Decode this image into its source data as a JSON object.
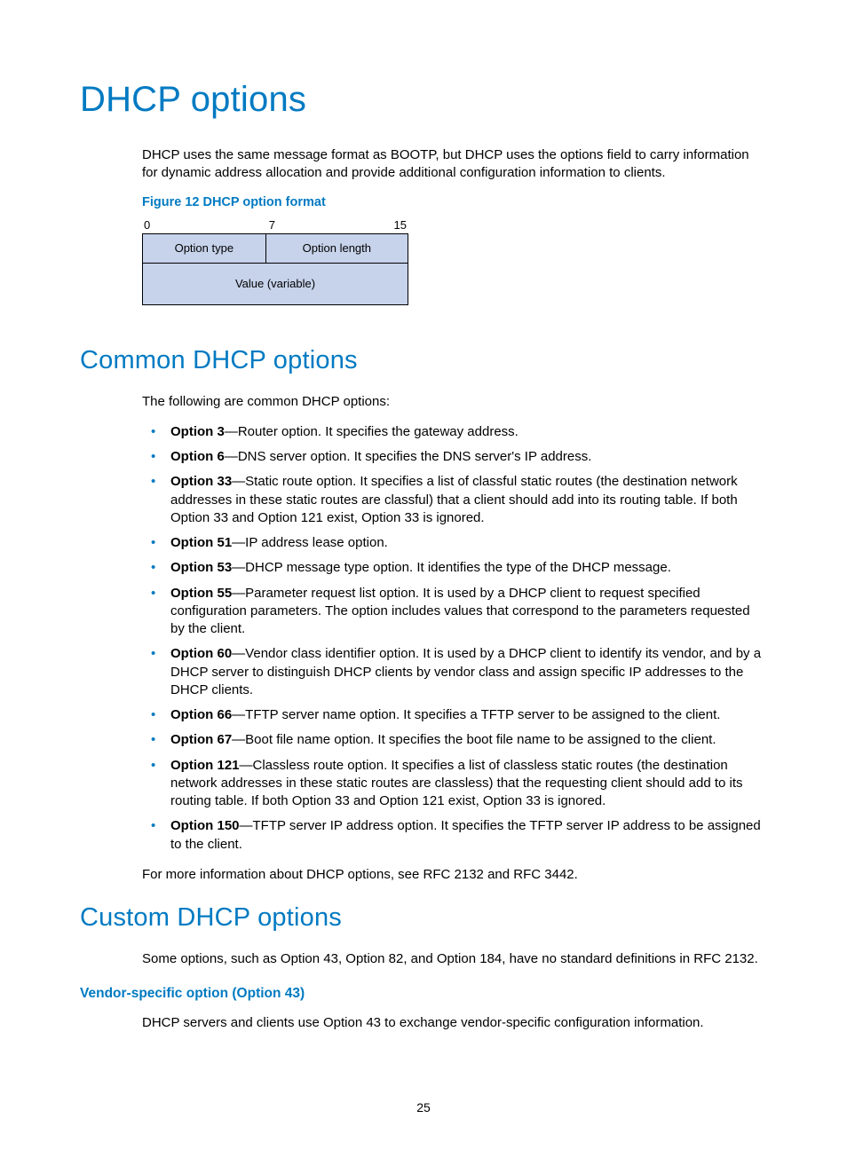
{
  "title": "DHCP options",
  "intro": "DHCP uses the same message format as BOOTP, but DHCP uses the options field to carry information for dynamic address allocation and provide additional configuration information to clients.",
  "figure": {
    "caption": "Figure 12 DHCP option format",
    "bits": {
      "left": "0",
      "mid": "7",
      "right": "15"
    },
    "cell_type": "Option type",
    "cell_len": "Option length",
    "cell_value": "Value (variable)"
  },
  "common": {
    "heading": "Common DHCP options",
    "lead": "The following are common DHCP options:",
    "items": [
      {
        "name": "Option 3",
        "desc": "—Router option. It specifies the gateway address."
      },
      {
        "name": "Option 6",
        "desc": "—DNS server option. It specifies the DNS server's IP address."
      },
      {
        "name": "Option 33",
        "desc": "—Static route option. It specifies a list of classful static routes (the destination network addresses in these static routes are classful) that a client should add into its routing table. If both Option 33 and Option 121 exist, Option 33 is ignored."
      },
      {
        "name": "Option 51",
        "desc": "—IP address lease option."
      },
      {
        "name": "Option 53",
        "desc": "—DHCP message type option. It identifies the type of the DHCP message."
      },
      {
        "name": "Option 55",
        "desc": "—Parameter request list option. It is used by a DHCP client to request specified configuration parameters. The option includes values that correspond to the parameters requested by the client."
      },
      {
        "name": "Option 60",
        "desc": "—Vendor class identifier option. It is used by a DHCP client to identify its vendor, and by a DHCP server to distinguish DHCP clients by vendor class and assign specific IP addresses to the DHCP clients."
      },
      {
        "name": "Option 66",
        "desc": "—TFTP server name option. It specifies a TFTP server to be assigned to the client."
      },
      {
        "name": "Option 67",
        "desc": "—Boot file name option. It specifies the boot file name to be assigned to the client."
      },
      {
        "name": "Option 121",
        "desc": "—Classless route option. It specifies a list of classless static routes (the destination network addresses in these static routes are classless) that the requesting client should add to its routing table. If both Option 33 and Option 121 exist, Option 33 is ignored."
      },
      {
        "name": "Option 150",
        "desc": "—TFTP server IP address option. It specifies the TFTP server IP address to be assigned to the client."
      }
    ],
    "footer": "For more information about DHCP options, see RFC 2132 and RFC 3442."
  },
  "custom": {
    "heading": "Custom DHCP options",
    "lead": "Some options, such as Option 43, Option 82, and Option 184, have no standard definitions in RFC 2132.",
    "sub_heading": "Vendor-specific option (Option 43)",
    "sub_body": "DHCP servers and clients use Option 43 to exchange vendor-specific configuration information."
  },
  "page_number": "25"
}
